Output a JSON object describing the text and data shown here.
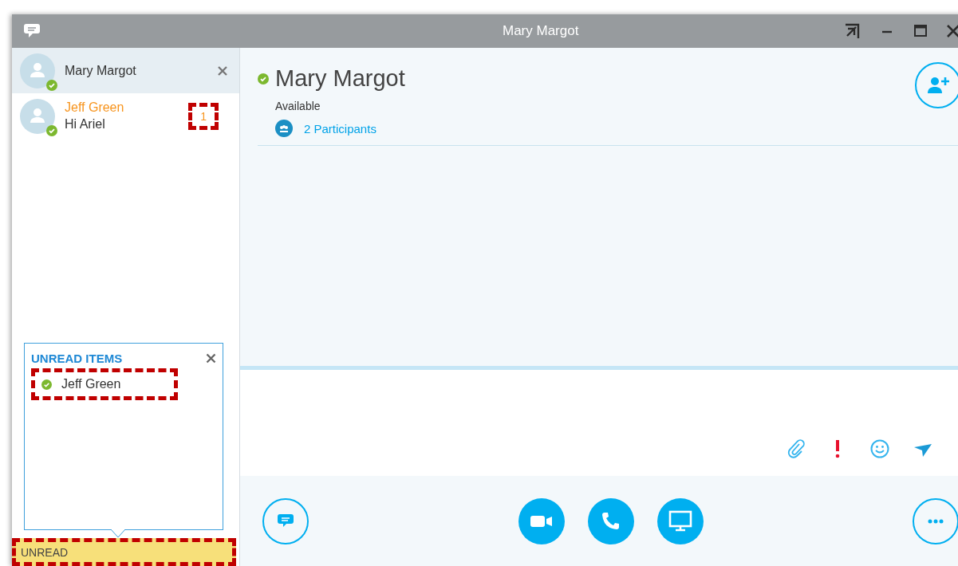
{
  "window": {
    "title": "Mary Margot"
  },
  "conversations": [
    {
      "name": "Mary Margot",
      "online": true,
      "selected": true,
      "unread": false
    },
    {
      "name": "Jeff Green",
      "preview": "Hi Ariel",
      "online": true,
      "selected": false,
      "unread": true,
      "unread_count": {
        "text": "1",
        "highlighted": true
      }
    }
  ],
  "contact": {
    "name": "Mary Margot",
    "online": true,
    "status": "Available",
    "participants": "2 Participants"
  },
  "unread_popup": {
    "title": "UNREAD ITEMS",
    "items": [
      {
        "name": "Jeff Green",
        "online": true,
        "highlighted": true
      }
    ]
  },
  "unread_bar": {
    "label": "UNREAD",
    "highlighted": true
  }
}
